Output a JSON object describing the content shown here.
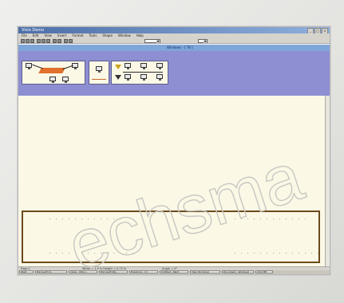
{
  "window": {
    "title": "Visio Demo",
    "controls": [
      "_",
      "□",
      "×"
    ]
  },
  "menu": [
    "File",
    "Edit",
    "View",
    "Insert",
    "Format",
    "Tools",
    "Shape",
    "Window",
    "Help"
  ],
  "toolbar": {
    "zoom_value": "75%",
    "font_value": "Arial"
  },
  "band": {
    "title": "Windows - [ 78 ]"
  },
  "status": {
    "left": "Page-1",
    "middle": "Width = 1.5 in  Height = 0.75 in",
    "right": "Angle = 0°"
  },
  "taskbar": [
    "Start",
    "Microsoft Vi...",
    "Inbox - Micro...",
    "Microsoft Wo...",
    "Exploring - C:\\",
    "Untitled - Paint",
    "Visio Technical",
    "Document - Wordpad",
    "4:52 PM"
  ],
  "ruler": {
    "upper_left": ". . . . . . . . . . . .",
    "upper_right": ". . . . . . . . . . . .",
    "lower_left": ". . . . . . . . . . . . . .",
    "lower_right": ". . . . . . . . . . . . . ."
  },
  "watermark": {
    "text": "echsma"
  }
}
